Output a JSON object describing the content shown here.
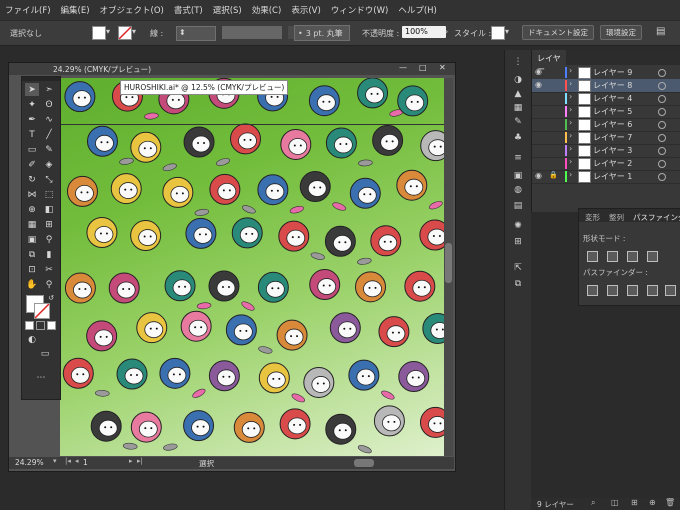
{
  "menu": {
    "items": [
      "ファイル(F)",
      "編集(E)",
      "オブジェクト(O)",
      "書式(T)",
      "選択(S)",
      "効果(C)",
      "表示(V)",
      "ウィンドウ(W)",
      "ヘルプ(H)"
    ]
  },
  "control_bar": {
    "selection_label": "選択なし",
    "stroke_label": "線 :",
    "stroke_profile": "3 pt. 丸筆",
    "opacity_label": "不透明度 :",
    "opacity_value": "100%",
    "style_label": "スタイル :",
    "doc_settings_button": "ドキュメント設定",
    "preferences_button": "環境設定"
  },
  "document": {
    "tab_title": "24.29% (CMYK/プレビュー)",
    "tooltip": "HUROSHIKI.ai* @ 12.5% (CMYK/プレビュー)",
    "zoom": "24.29%",
    "page": "1",
    "status": "選択"
  },
  "layers_panel": {
    "tab": "レイヤー",
    "footer": "9 レイヤー",
    "layers": [
      {
        "name": "レイヤー 9",
        "color": "#4f7fff",
        "visible": true,
        "locked": false,
        "selected": false
      },
      {
        "name": "レイヤー 8",
        "color": "#ff4f4f",
        "visible": true,
        "locked": false,
        "selected": true
      },
      {
        "name": "レイヤー 4",
        "color": "#7fdfff",
        "visible": false,
        "locked": false,
        "selected": false
      },
      {
        "name": "レイヤー 5",
        "color": "#ff7fff",
        "visible": false,
        "locked": false,
        "selected": false
      },
      {
        "name": "レイヤー 6",
        "color": "#4fbf4f",
        "visible": false,
        "locked": false,
        "selected": false
      },
      {
        "name": "レイヤー 7",
        "color": "#ffbf4f",
        "visible": false,
        "locked": false,
        "selected": false
      },
      {
        "name": "レイヤー 3",
        "color": "#bf7fff",
        "visible": false,
        "locked": false,
        "selected": false
      },
      {
        "name": "レイヤー 2",
        "color": "#ff4fbf",
        "visible": false,
        "locked": false,
        "selected": false
      },
      {
        "name": "レイヤー 1",
        "color": "#4fff4f",
        "visible": true,
        "locked": true,
        "selected": false
      }
    ]
  },
  "pathfinder_panel": {
    "tabs": [
      "変形",
      "整列",
      "パスファインダー"
    ],
    "shape_modes_label": "形状モード :",
    "pathfinders_label": "パスファインダー :"
  },
  "colors": {
    "accent_selected": "#4b5a6f",
    "artboard_top": "#5fae2e",
    "artboard_bottom": "#dff0cc"
  }
}
